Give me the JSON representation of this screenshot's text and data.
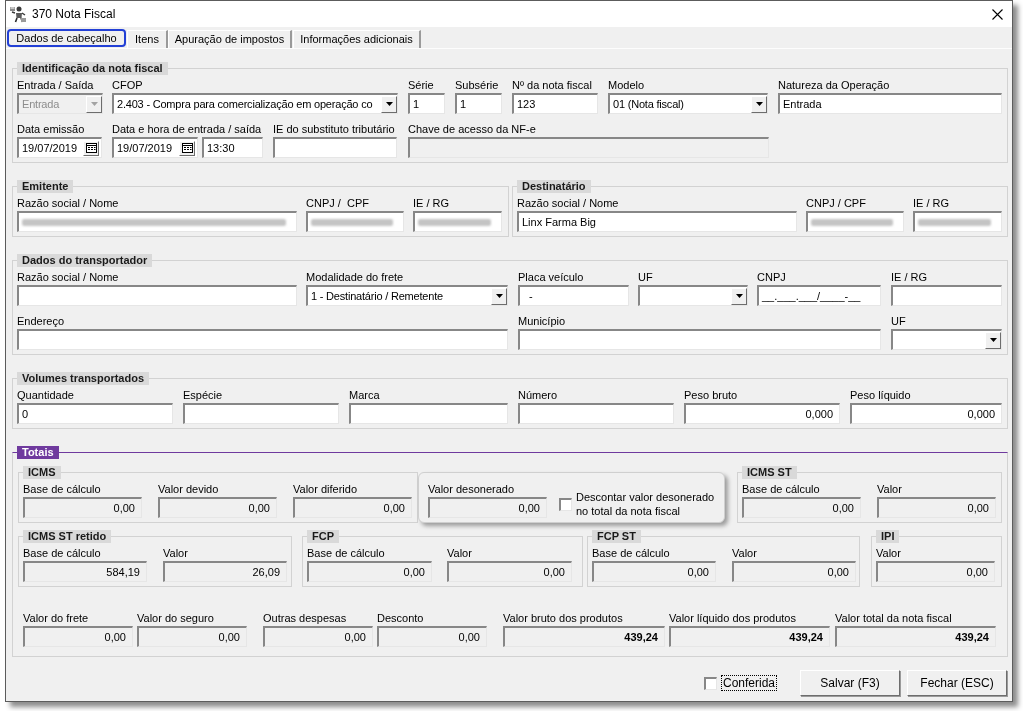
{
  "window": {
    "title": "370 Nota Fiscal"
  },
  "tabs": [
    {
      "label": "Dados de cabeçalho",
      "selected": true
    },
    {
      "label": "Itens",
      "selected": false
    },
    {
      "label": "Apuração de impostos",
      "selected": false
    },
    {
      "label": "Informações adicionais",
      "selected": false
    }
  ],
  "identificacao": {
    "title": "Identificação da nota fiscal",
    "fields": [
      {
        "label": "Entrada / Saída",
        "kind": "combo",
        "value": "Entrada",
        "disabled": true
      },
      {
        "label": "CFOP",
        "kind": "combo",
        "value": "2.403 - Compra para comercialização em operação co",
        "disabled": false
      },
      {
        "label": "Série",
        "kind": "text",
        "value": "1",
        "disabled": false
      },
      {
        "label": "Subsérie",
        "kind": "text",
        "value": "1",
        "disabled": false
      },
      {
        "label": "Nº da nota fiscal",
        "kind": "text",
        "value": "123",
        "disabled": false
      },
      {
        "label": "Modelo",
        "kind": "combo",
        "value": "01 (Nota fiscal)",
        "disabled": false
      },
      {
        "label": "Natureza da Operação",
        "kind": "text",
        "value": "Entrada",
        "disabled": false
      },
      {
        "label": "Data emissão",
        "kind": "date",
        "value": "19/07/2019",
        "disabled": false
      },
      {
        "label": "Data e hora de entrada / saída",
        "kind": "date",
        "value": "19/07/2019",
        "disabled": false
      },
      {
        "kind": "text",
        "value": "13:30",
        "disabled": false
      },
      {
        "label": "IE do substituto tributário",
        "kind": "text",
        "disabled": false
      },
      {
        "label": "Chave de acesso da NF-e",
        "kind": "text",
        "disabled": true
      }
    ]
  },
  "emitente": {
    "title": "Emitente",
    "fields": [
      {
        "label": "Razão social / Nome",
        "kind": "text",
        "redacted": true
      },
      {
        "label": "CNPJ /  CPF",
        "kind": "text",
        "redacted": true
      },
      {
        "label": "IE / RG",
        "kind": "text",
        "redacted": true
      }
    ]
  },
  "destinatario": {
    "title": "Destinatário",
    "fields": [
      {
        "label": "Razão social / Nome",
        "kind": "text",
        "value": "Linx Farma Big",
        "redacted": false
      },
      {
        "label": "CNPJ / CPF",
        "kind": "text",
        "redacted": true
      },
      {
        "label": "IE / RG",
        "kind": "text",
        "redacted": true
      }
    ]
  },
  "transportador": {
    "title": "Dados do transportador",
    "fields": [
      {
        "label": "Razão social / Nome",
        "kind": "text"
      },
      {
        "label": "Modalidade do frete",
        "kind": "combo",
        "value": "1 - Destinatário / Remetente"
      },
      {
        "label": "Placa veículo",
        "kind": "text",
        "value": "  -"
      },
      {
        "label": "UF",
        "kind": "combo"
      },
      {
        "label": "CNPJ",
        "kind": "text",
        "value": "__.___.___/____-__"
      },
      {
        "label": "IE / RG",
        "kind": "text"
      },
      {
        "label": "Endereço",
        "kind": "text"
      },
      {
        "label": "Município",
        "kind": "text"
      },
      {
        "label": "UF",
        "kind": "combo"
      }
    ]
  },
  "volumes": {
    "title": "Volumes transportados",
    "fields": [
      {
        "label": "Quantidade",
        "kind": "text",
        "value": "0"
      },
      {
        "label": "Espécie",
        "kind": "text"
      },
      {
        "label": "Marca",
        "kind": "text"
      },
      {
        "label": "Número",
        "kind": "text"
      },
      {
        "label": "Peso bruto",
        "kind": "amount",
        "value": "0,000"
      },
      {
        "label": "Peso líquido",
        "kind": "amount",
        "value": "0,000"
      }
    ]
  },
  "totais": {
    "title": "Totais",
    "groups": [
      {
        "kind": "group",
        "title": "ICMS",
        "fields": [
          {
            "label": "Base de cálculo",
            "kind": "amount",
            "value": "0,00",
            "disabled": true
          },
          {
            "label": "Valor devido",
            "kind": "amount",
            "value": "0,00",
            "disabled": true
          },
          {
            "label": "Valor diferido",
            "kind": "amount",
            "value": "0,00",
            "disabled": true
          }
        ]
      },
      {
        "kind": "panel",
        "fields": [
          {
            "label": "Valor desonerado",
            "kind": "amount",
            "value": "0,00",
            "disabled": true
          }
        ],
        "checkbox": {
          "label": "Descontar valor desonerado\nno total da nota fiscal",
          "checked": false
        }
      },
      {
        "kind": "group",
        "title": "ICMS ST",
        "fields": [
          {
            "label": "Base de cálculo",
            "kind": "amount",
            "value": "0,00",
            "disabled": true
          },
          {
            "label": "Valor",
            "kind": "amount",
            "value": "0,00",
            "disabled": true
          }
        ]
      },
      {
        "kind": "group",
        "title": "ICMS ST retido",
        "fields": [
          {
            "label": "Base de cálculo",
            "kind": "amount",
            "value": "584,19",
            "disabled": true
          },
          {
            "label": "Valor",
            "kind": "amount",
            "value": "26,09",
            "disabled": true
          }
        ]
      },
      {
        "kind": "group",
        "title": "FCP",
        "fields": [
          {
            "label": "Base de cálculo",
            "kind": "amount",
            "value": "0,00",
            "disabled": true
          },
          {
            "label": "Valor",
            "kind": "amount",
            "value": "0,00",
            "disabled": true
          }
        ]
      },
      {
        "kind": "group",
        "title": "FCP ST",
        "fields": [
          {
            "label": "Base de cálculo",
            "kind": "amount",
            "value": "0,00",
            "disabled": true
          },
          {
            "label": "Valor",
            "kind": "amount",
            "value": "0,00",
            "disabled": true
          }
        ]
      },
      {
        "kind": "group",
        "title": "IPI",
        "fields": [
          {
            "label": "Valor",
            "kind": "amount",
            "value": "0,00",
            "disabled": true
          }
        ]
      }
    ],
    "summary": [
      {
        "label": "Valor do frete",
        "kind": "amount",
        "value": "0,00",
        "disabled": true
      },
      {
        "label": "Valor do seguro",
        "kind": "amount",
        "value": "0,00",
        "disabled": true
      },
      {
        "label": "Outras despesas",
        "kind": "amount",
        "value": "0,00",
        "disabled": true
      },
      {
        "label": "Desconto",
        "kind": "amount",
        "value": "0,00",
        "disabled": true
      },
      {
        "label": "Valor bruto dos produtos",
        "kind": "total",
        "value": "439,24",
        "disabled": true
      },
      {
        "label": "Valor líquido dos produtos",
        "kind": "total",
        "value": "439,24",
        "disabled": true
      },
      {
        "label": "Valor total da nota fiscal",
        "kind": "total",
        "value": "439,24",
        "disabled": true
      }
    ]
  },
  "footer": {
    "checkbox": {
      "label": "Conferida",
      "checked": false,
      "focused": true
    },
    "buttons": [
      "Salvar (F3)",
      "Fechar (ESC)"
    ]
  }
}
